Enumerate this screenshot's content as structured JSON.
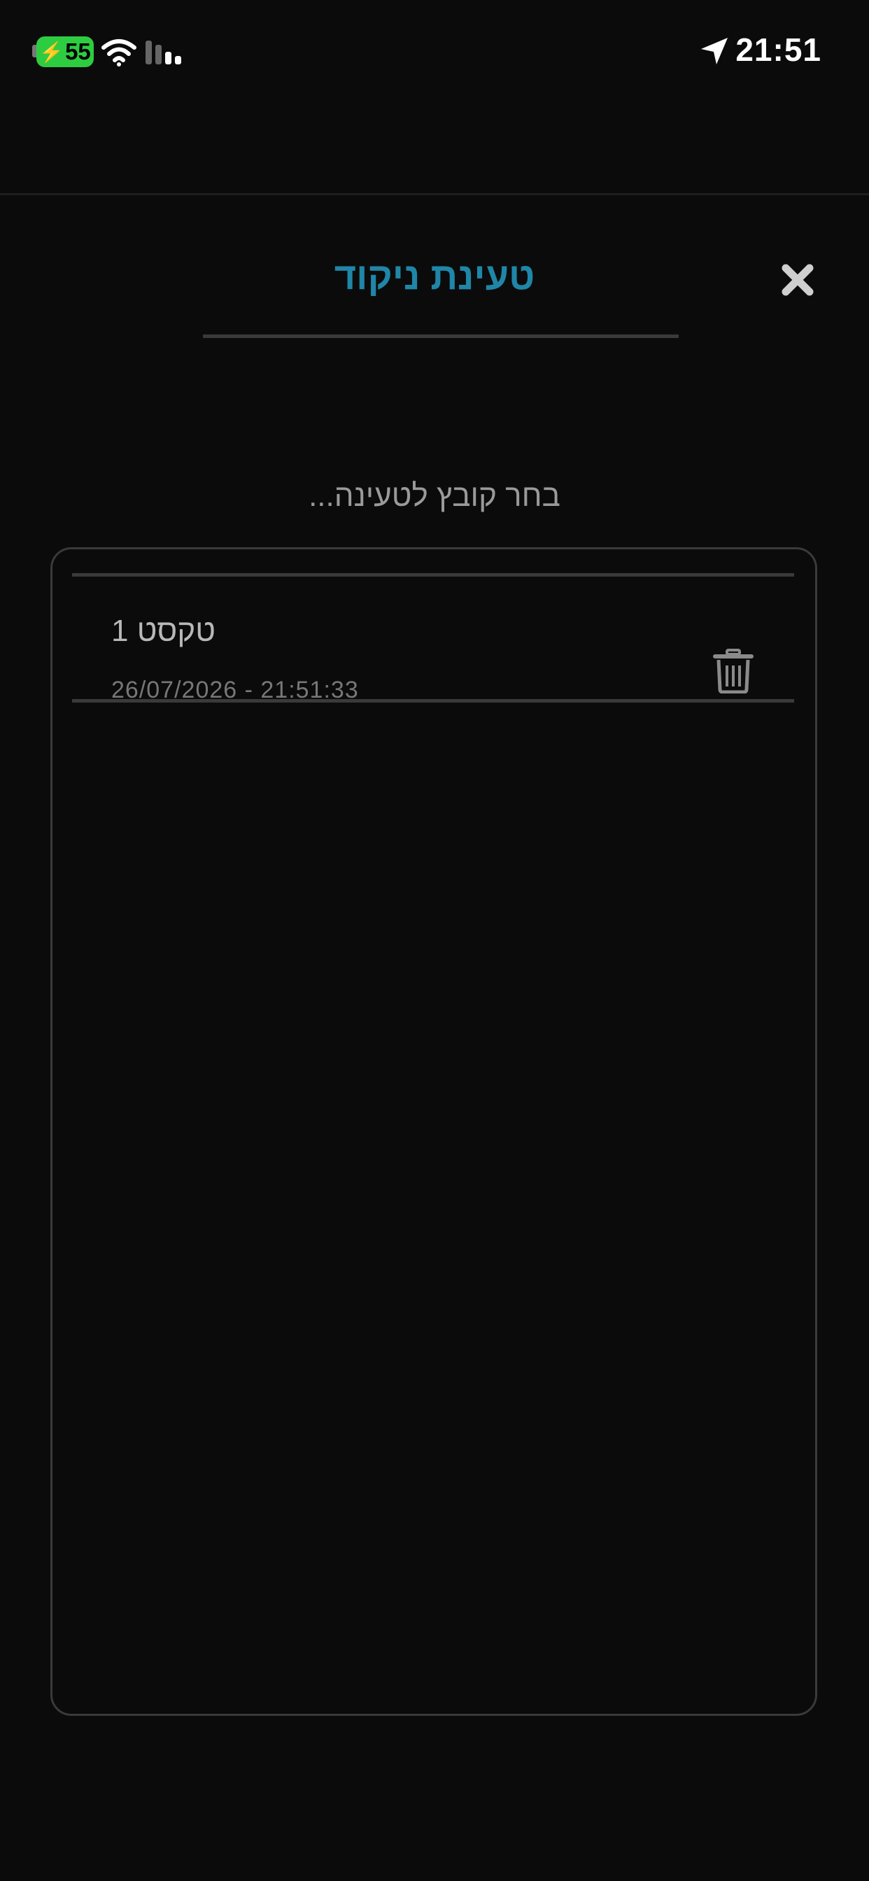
{
  "status_bar": {
    "battery_level": "55",
    "time": "21:51",
    "battery_color": "#2ecc40"
  },
  "dialog": {
    "title": "טעינת ניקוד",
    "title_color": "#1f86a8",
    "prompt": "בחר קובץ לטעינה...",
    "close_icon": "close-x-icon"
  },
  "file_list": {
    "items": [
      {
        "name": "טקסט 1",
        "date": "26/07/2026 - 21:51:33",
        "delete_icon": "trash-icon"
      }
    ]
  }
}
